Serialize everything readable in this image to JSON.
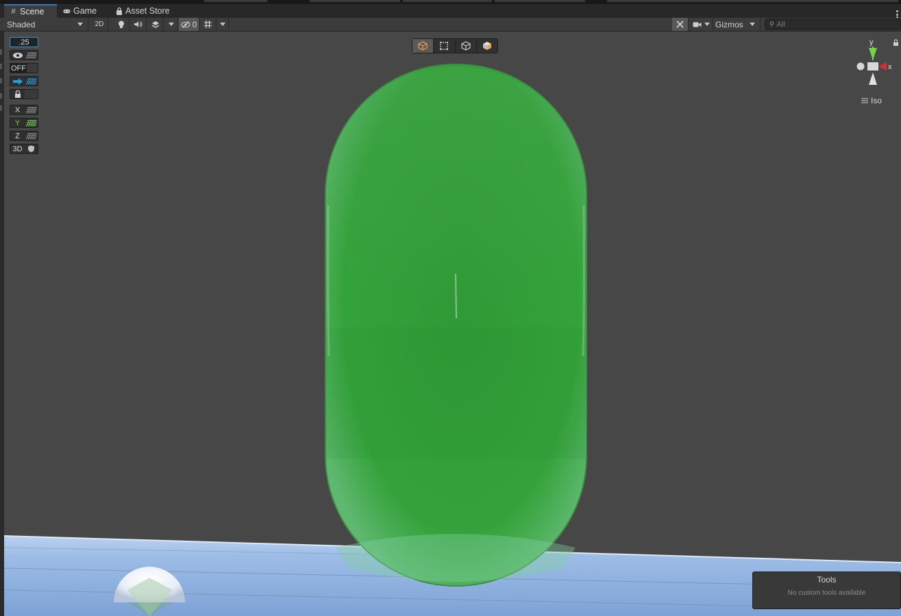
{
  "tabs": [
    {
      "label": "Scene",
      "icon": "scene-grid-icon",
      "active": true
    },
    {
      "label": "Game",
      "icon": "gamepad-icon",
      "active": false
    },
    {
      "label": "Asset Store",
      "icon": "bag-icon",
      "active": false
    }
  ],
  "toolbar": {
    "draw_mode": "Shaded",
    "mode_2d": "2D",
    "hidden_count": "0",
    "gizmos_label": "Gizmos",
    "search_placeholder": "All"
  },
  "overlay": {
    "snap_value": ".25",
    "grid_off_label": "OFF",
    "axis_x": "X",
    "axis_y": "Y",
    "axis_z": "Z",
    "mode_3d": "3D"
  },
  "gizmo": {
    "y_label": "y",
    "x_label": "x",
    "projection": "Iso"
  },
  "tools_panel": {
    "title": "Tools",
    "message": "No custom tools available"
  },
  "colors": {
    "capsule_green": "#34a23a",
    "ground_blue": "#93b6e3",
    "accent_blue": "#3a79bb",
    "snap_blue": "#1aa0e0",
    "axis_y_green": "#6fd44a",
    "axis_x_red": "#d23030"
  }
}
